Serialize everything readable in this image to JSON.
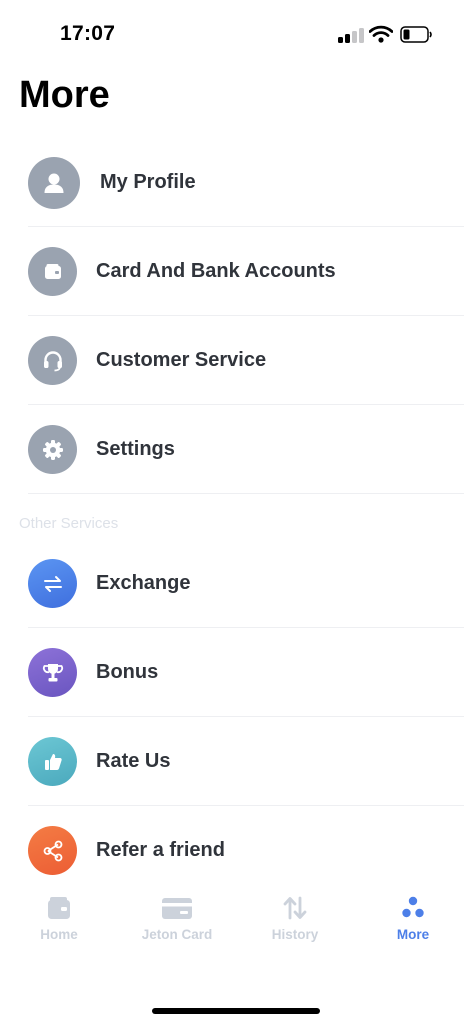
{
  "status_bar": {
    "time": "17:07"
  },
  "header": {
    "title": "More"
  },
  "account_items": [
    {
      "label": "My Profile",
      "icon": "user-icon",
      "color": "#9aa3b0"
    },
    {
      "label": "Card And Bank Accounts",
      "icon": "wallet-icon",
      "color": "#9aa3b0"
    },
    {
      "label": "Customer Service",
      "icon": "headset-icon",
      "color": "#9aa3b0"
    },
    {
      "label": "Settings",
      "icon": "gear-icon",
      "color": "#9aa3b0"
    }
  ],
  "other_services": {
    "header": "Other Services",
    "items": [
      {
        "label": "Exchange",
        "icon": "exchange-icon",
        "color": "#4a7fe6"
      },
      {
        "label": "Bonus",
        "icon": "trophy-icon",
        "color": "#7b64cc"
      },
      {
        "label": "Rate Us",
        "icon": "thumbs-up-icon",
        "color": "#5bbac8"
      },
      {
        "label": "Refer a friend",
        "icon": "share-icon",
        "color": "#f06a3c"
      }
    ]
  },
  "tab_bar": {
    "tabs": [
      {
        "label": "Home",
        "icon": "wallet-icon",
        "active": false
      },
      {
        "label": "Jeton Card",
        "icon": "card-icon",
        "active": false
      },
      {
        "label": "History",
        "icon": "arrows-updown-icon",
        "active": false
      },
      {
        "label": "More",
        "icon": "dots-icon",
        "active": true
      }
    ],
    "active_color": "#4d7fe8",
    "inactive_color": "#ccd2db"
  }
}
